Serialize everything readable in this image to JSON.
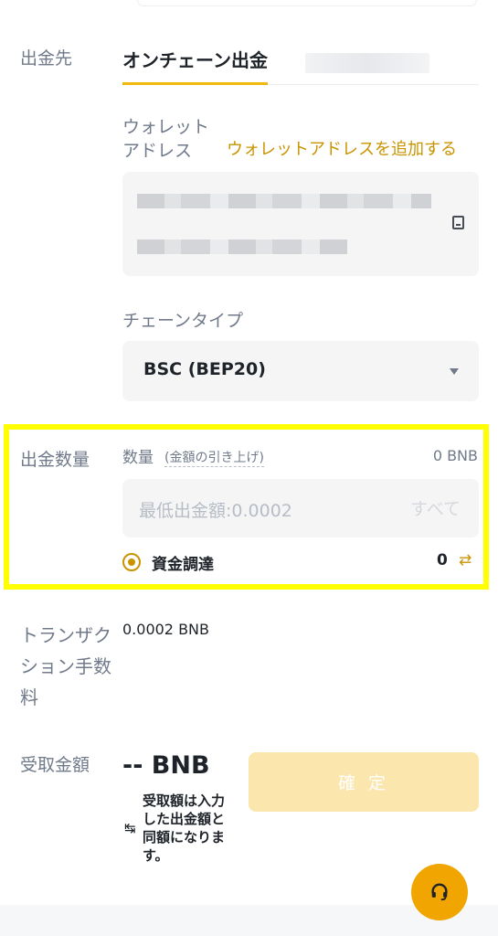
{
  "destination": {
    "label": "出金先",
    "active_tab": "オンチェーン出金"
  },
  "wallet": {
    "label": "ウォレットアドレス",
    "add_link": "ウォレットアドレスを追加する"
  },
  "chain": {
    "label": "チェーンタイプ",
    "value": "BSC (BEP20)"
  },
  "amount": {
    "label": "出金数量",
    "quantity_label": "数量",
    "raise_link": "(金額の引き上げ)",
    "balance": "0 BNB",
    "placeholder": "最低出金額:0.0002",
    "all_button": "すべて",
    "fund_option": "資金調達",
    "fund_value": "0"
  },
  "fee": {
    "label": "トランザクション手数料",
    "value": "0.0002 BNB"
  },
  "receive": {
    "label": "受取金額",
    "amount": "-- BNB",
    "note": "受取額は入力した出金額と同額になります。"
  },
  "confirm_button": "確 定",
  "icons": {
    "address_book": "address-book-icon",
    "dropdown": "caret-down-icon",
    "radio": "radio-selected-icon",
    "swap": "swap-icon",
    "support": "headset-icon"
  },
  "colors": {
    "accent": "#f0b90b",
    "link": "#c99400",
    "highlight": "#ffff00",
    "confirm_disabled": "#fbe6ad"
  }
}
